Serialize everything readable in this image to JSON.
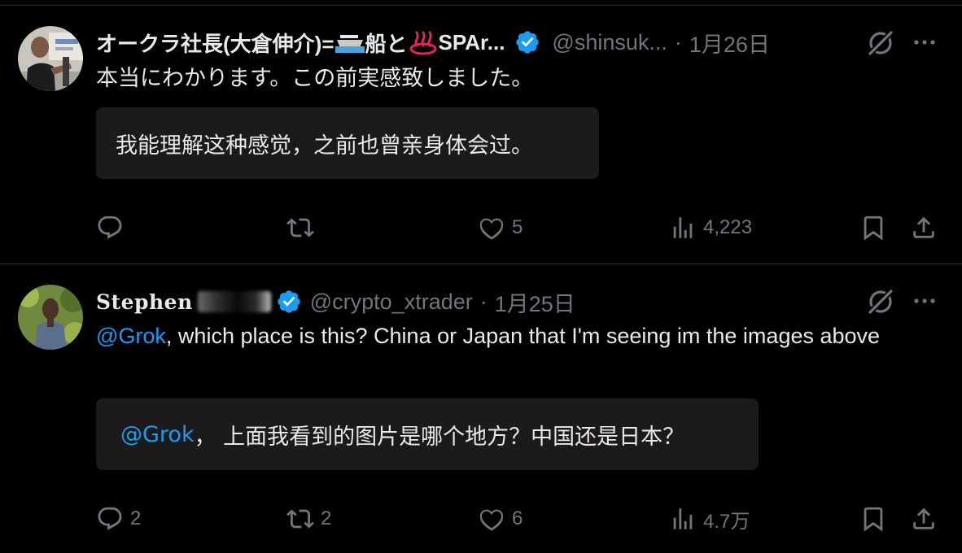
{
  "tweets": [
    {
      "display_name_part1": "オークラ社長(大倉伸介)=",
      "display_name_part2": "船と",
      "display_name_part3": "SPAr...",
      "handle": "@shinsuk...",
      "separator": "·",
      "date": "1月26日",
      "text": "本当にわかります。この前実感致しました。",
      "translation": "我能理解这种感觉，之前也曾亲身体会过。",
      "replies": "",
      "reposts": "",
      "likes": "5",
      "views": "4,223",
      "icons": {
        "name_emojis": [
          "ship-icon",
          "hot-spring-icon"
        ],
        "verified": "verified-icon",
        "grok": "grok-icon",
        "more": "more-icon"
      }
    },
    {
      "display_name": "Stephen",
      "handle": "@crypto_xtrader",
      "separator": "·",
      "date": "1月25日",
      "mention": "@Grok",
      "text": ", which place is this? China or Japan that I'm seeing im the images above",
      "translation_mention": "@Grok",
      "translation_rest": "， 上面我看到的图片是哪个地方？中国还是日本？",
      "replies": "2",
      "reposts": "2",
      "likes": "6",
      "views": "4.7万",
      "icons": {
        "verified": "verified-icon",
        "grok": "grok-icon",
        "more": "more-icon"
      }
    }
  ],
  "colors": {
    "background": "#000000",
    "text_primary": "#e7e9ea",
    "text_secondary": "#71767b",
    "link": "#1d9bf0",
    "verified_badge": "#1d9bf0",
    "translation_box": "#1c1a1a",
    "divider": "#2f3336"
  }
}
